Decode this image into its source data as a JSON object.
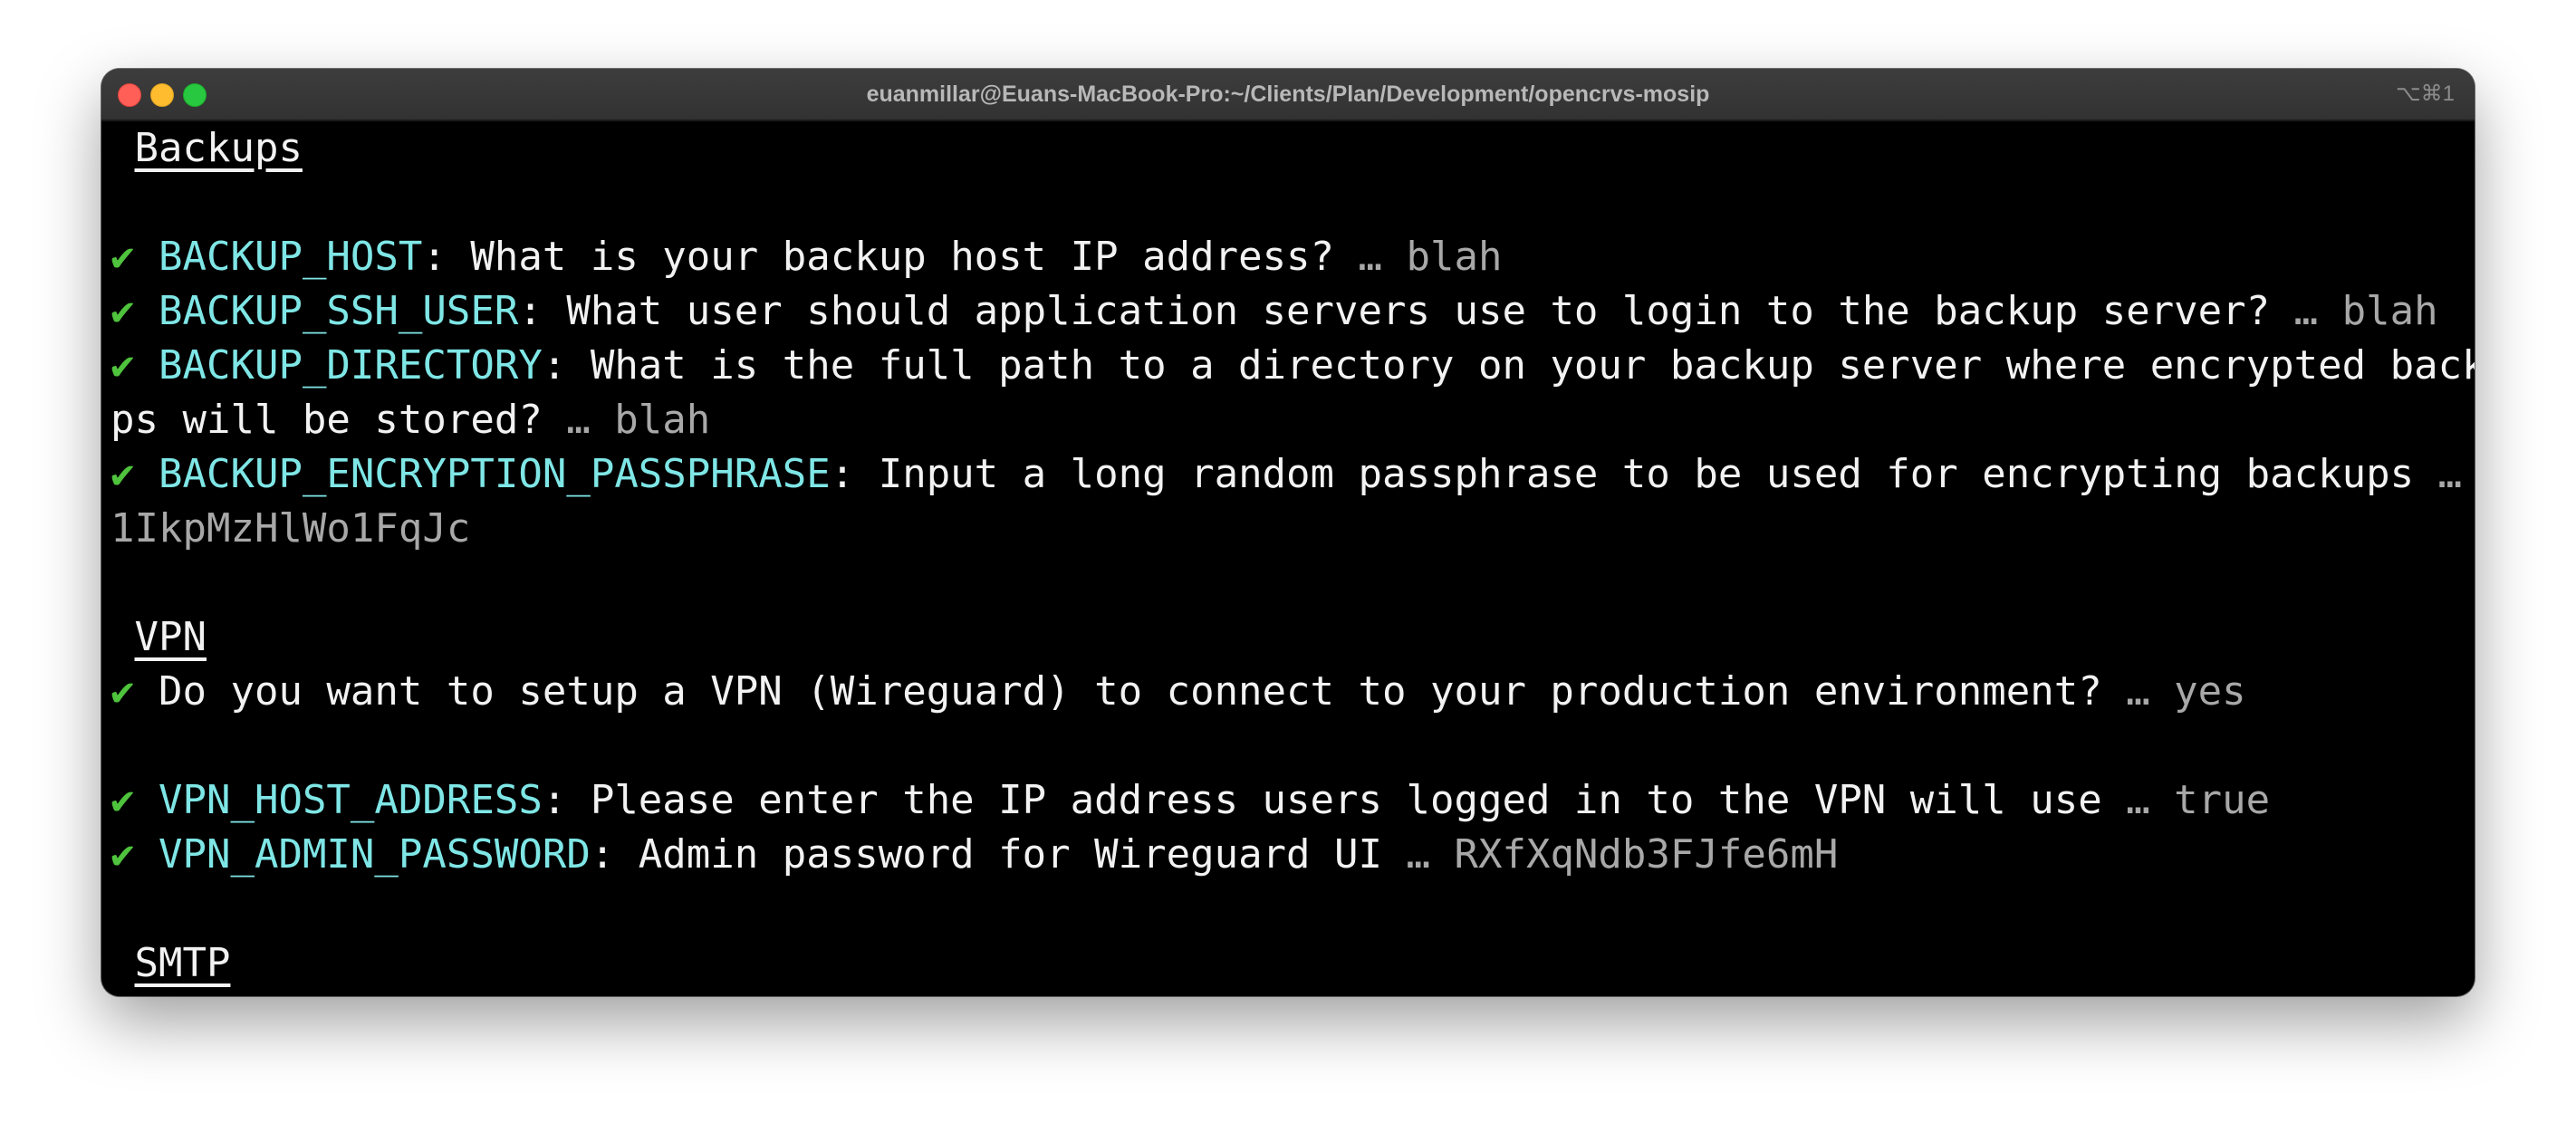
{
  "window": {
    "title": "euanmillar@Euans-MacBook-Pro:~/Clients/Plan/Development/opencrvs-mosip",
    "shortcut": "⌥⌘1"
  },
  "terminal": {
    "check_glyph": "✔",
    "backups": {
      "heading": "Backups",
      "host": {
        "key": "BACKUP_HOST",
        "question": ": What is your backup host IP address? ",
        "answer": "… blah"
      },
      "ssh_user": {
        "key": "BACKUP_SSH_USER",
        "question": ": What user should application servers use to login to the backup server? ",
        "answer": "… blah"
      },
      "directory": {
        "key": "BACKUP_DIRECTORY",
        "question_line1": ": What is the full path to a directory on your backup server where encrypted backu",
        "question_line2": "ps will be stored? ",
        "answer": "… blah"
      },
      "passphrase": {
        "key": "BACKUP_ENCRYPTION_PASSPHRASE",
        "question": ": Input a long random passphrase to be used for encrypting backups ",
        "answer_line1": "… T",
        "answer_line2": "1IkpMzHlWo1FqJc"
      }
    },
    "vpn": {
      "heading": "VPN",
      "setup": {
        "question": "Do you want to setup a VPN (Wireguard) to connect to your production environment? ",
        "answer": "… yes"
      },
      "host_address": {
        "key": "VPN_HOST_ADDRESS",
        "question": ": Please enter the IP address users logged in to the VPN will use ",
        "answer": "… true"
      },
      "admin_password": {
        "key": "VPN_ADMIN_PASSWORD",
        "question": ": Admin password for Wireguard UI ",
        "answer": "… RXfXqNdb3FJfe6mH"
      }
    },
    "smtp": {
      "heading": "SMTP"
    }
  }
}
